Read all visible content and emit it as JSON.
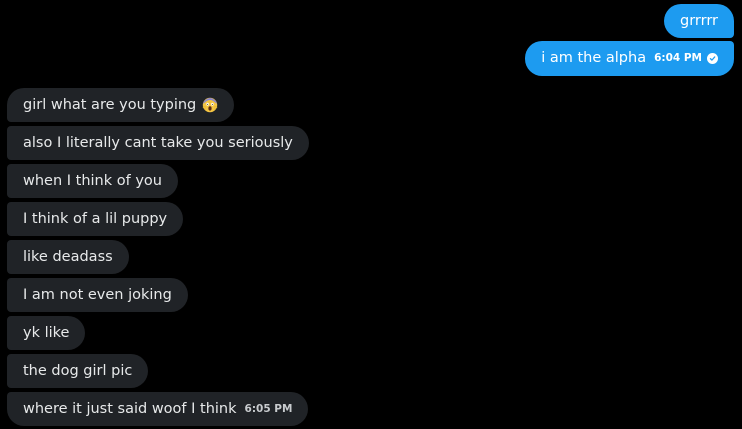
{
  "colors": {
    "background": "#000000",
    "outgoing_bubble": "#1d9bf0",
    "incoming_bubble": "#202327",
    "incoming_text": "#e7e9ea"
  },
  "outgoing": [
    {
      "text": "grrrrr"
    },
    {
      "text": "i am the alpha",
      "time": "6:04 PM",
      "status_icon": "read-check-icon"
    }
  ],
  "incoming": [
    {
      "text": "girl what are you typing",
      "emoji": "screaming-face-emoji"
    },
    {
      "text": "also I literally cant take you seriously"
    },
    {
      "text": "when I think of you"
    },
    {
      "text": "I think of a lil puppy"
    },
    {
      "text": "like deadass"
    },
    {
      "text": "I am not even joking"
    },
    {
      "text": "yk like"
    },
    {
      "text": "the dog girl pic"
    },
    {
      "text": "where it just said woof I think",
      "time": "6:05 PM"
    }
  ]
}
